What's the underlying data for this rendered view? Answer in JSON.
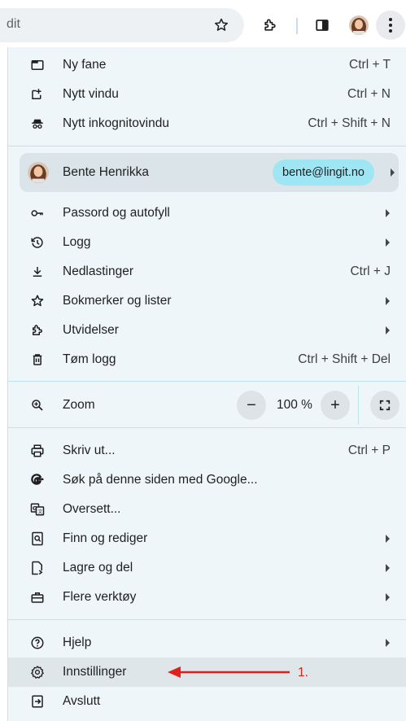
{
  "toolbar": {
    "omnibox_text": "dit",
    "icons": [
      "star-icon",
      "extensions-icon",
      "side-panel-icon",
      "avatar",
      "more-vert-icon"
    ]
  },
  "menu": {
    "group1": [
      {
        "label": "Ny fane",
        "shortcut": "Ctrl + T",
        "icon": "new-tab-icon"
      },
      {
        "label": "Nytt vindu",
        "shortcut": "Ctrl + N",
        "icon": "new-window-icon"
      },
      {
        "label": "Nytt inkognitovindu",
        "shortcut": "Ctrl + Shift + N",
        "icon": "incognito-icon"
      }
    ],
    "profile": {
      "name": "Bente Henrikka",
      "email": "bente@lingit.no"
    },
    "group2": [
      {
        "label": "Passord og autofyll",
        "icon": "key-icon",
        "submenu": true
      },
      {
        "label": "Logg",
        "icon": "history-icon",
        "submenu": true
      },
      {
        "label": "Nedlastinger",
        "shortcut": "Ctrl + J",
        "icon": "download-icon"
      },
      {
        "label": "Bokmerker og lister",
        "icon": "star-icon",
        "submenu": true
      },
      {
        "label": "Utvidelser",
        "icon": "extensions-icon",
        "submenu": true
      },
      {
        "label": "Tøm logg",
        "shortcut": "Ctrl + Shift + Del",
        "icon": "trash-icon"
      }
    ],
    "zoom": {
      "label": "Zoom",
      "minus": "−",
      "value": "100 %",
      "plus": "+"
    },
    "group3": [
      {
        "label": "Skriv ut...",
        "shortcut": "Ctrl + P",
        "icon": "print-icon"
      },
      {
        "label": "Søk på denne siden med Google...",
        "icon": "google-icon"
      },
      {
        "label": "Oversett...",
        "icon": "translate-icon"
      },
      {
        "label": "Finn og rediger",
        "icon": "find-icon",
        "submenu": true
      },
      {
        "label": "Lagre og del",
        "icon": "save-share-icon",
        "submenu": true
      },
      {
        "label": "Flere verktøy",
        "icon": "toolbox-icon",
        "submenu": true
      }
    ],
    "group4": [
      {
        "label": "Hjelp",
        "icon": "help-icon",
        "submenu": true
      },
      {
        "label": "Innstillinger",
        "icon": "settings-icon"
      },
      {
        "label": "Avslutt",
        "icon": "exit-icon"
      }
    ]
  },
  "annotation": {
    "label": "1.",
    "color": "#e0201b"
  },
  "colors": {
    "menu_bg": "#eef6f9",
    "email_chip": "#9fe6f5",
    "divider": "#bfe3ea"
  }
}
